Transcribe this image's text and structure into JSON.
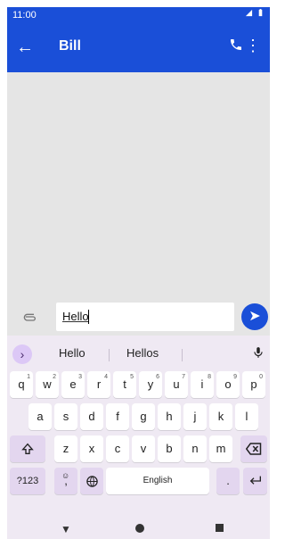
{
  "status_bar": {
    "time": "11:00",
    "icons": [
      "signal-icon",
      "battery-icon"
    ]
  },
  "app_bar": {
    "title": "Bill",
    "back_icon": "arrow-left-icon",
    "call_icon": "phone-icon",
    "more_icon": "more-vertical-icon"
  },
  "composer": {
    "input_value": "Hello",
    "attach_icon": "paperclip-icon",
    "send_icon": "send-icon"
  },
  "keyboard": {
    "suggestions": [
      "Hello",
      "Hellos"
    ],
    "row1": [
      {
        "label": "q",
        "hint": "1"
      },
      {
        "label": "w",
        "hint": "2"
      },
      {
        "label": "e",
        "hint": "3"
      },
      {
        "label": "r",
        "hint": "4"
      },
      {
        "label": "t",
        "hint": "5"
      },
      {
        "label": "y",
        "hint": "6"
      },
      {
        "label": "u",
        "hint": "7"
      },
      {
        "label": "i",
        "hint": "8"
      },
      {
        "label": "o",
        "hint": "9"
      },
      {
        "label": "p",
        "hint": "0"
      }
    ],
    "row2": [
      "a",
      "s",
      "d",
      "f",
      "g",
      "h",
      "j",
      "k",
      "l"
    ],
    "row3": [
      "z",
      "x",
      "c",
      "v",
      "b",
      "n",
      "m"
    ],
    "bottom": {
      "symbols_label": "?123",
      "comma_label": ",",
      "space_label": "English",
      "period_label": "."
    }
  },
  "colors": {
    "accent": "#1a4fd8",
    "keyboard_bg": "#efe9f3",
    "key_bg": "#ffffff",
    "key_dark": "#e3d6ef"
  }
}
